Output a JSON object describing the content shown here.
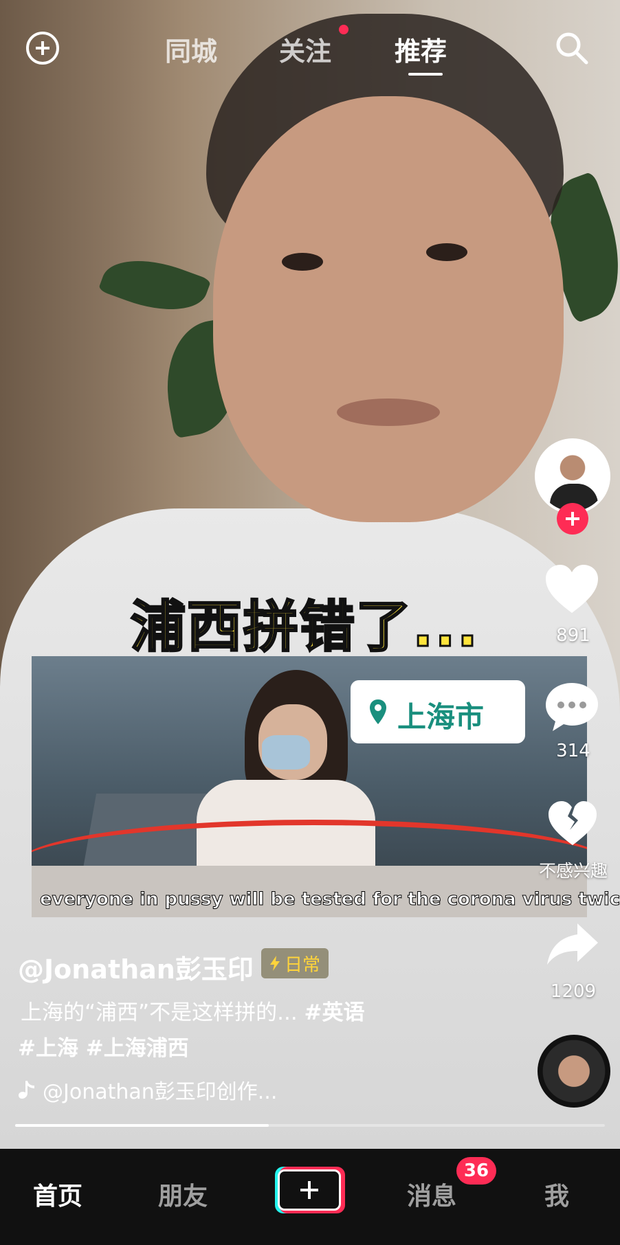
{
  "top_nav": {
    "tabs": [
      {
        "label": "同城"
      },
      {
        "label": "关注",
        "has_dot": true
      },
      {
        "label": "推荐",
        "active": true
      }
    ]
  },
  "video": {
    "caption": "浦西拼错了...",
    "location": "上海市",
    "subtitle": "everyone in pussy will be tested for the corona virus twice"
  },
  "actions": {
    "like_count": "891",
    "comment_count": "314",
    "not_interested_label": "不感兴趣",
    "share_count": "1209"
  },
  "post": {
    "username": "@Jonathan彭玉印",
    "tag": "日常",
    "description_text": "上海的“浦西”不是这样拼的...",
    "hashtags_line1": "#英语",
    "hashtags_line2": "#上海 #上海浦西",
    "music": "@Jonathan彭玉印创作...",
    "progress_fraction": 0.43
  },
  "bottom_nav": {
    "home": "首页",
    "friends": "朋友",
    "messages": "消息",
    "messages_badge": "36",
    "me": "我"
  },
  "colors": {
    "accent_red": "#fe2c55",
    "accent_cyan": "#25f4ee",
    "caption_yellow": "#ffe43c",
    "location_green": "#1a8f7e"
  }
}
